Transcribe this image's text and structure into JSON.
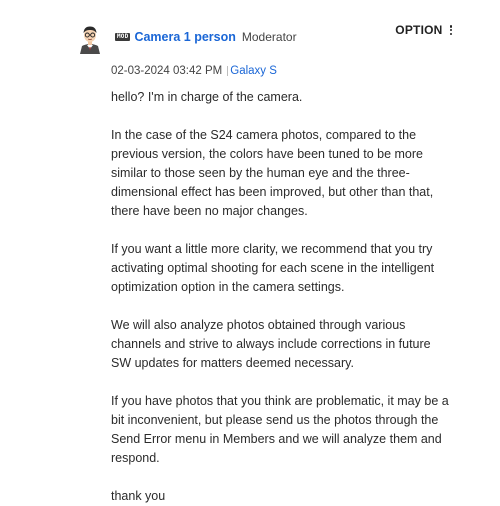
{
  "post": {
    "badge": "MOD",
    "author": "Camera 1 person",
    "role": "Moderator",
    "option_label": "OPTION",
    "date": "02-03-2024 03:42 PM",
    "board": "Galaxy S",
    "paragraphs": [
      "hello? I'm in charge of the camera.",
      "In the case of the S24 camera photos, compared to the previous version, the colors have been tuned to be more similar to those seen by the human eye and the three-dimensional effect has been improved, but other than that, there have been no major changes.",
      "If you want a little more clarity, we recommend that you try activating optimal shooting for each scene in the intelligent optimization option in the camera settings.",
      "We will also analyze photos obtained through various channels and strive to always include corrections in future SW updates for matters deemed necessary.",
      "If you have photos that you think are problematic, it may be a bit inconvenient, but please send us the photos through the Send Error menu in Members and we will analyze them and respond.",
      "thank you"
    ]
  },
  "colors": {
    "link": "#1a66d6",
    "text": "#2b2b2b",
    "badge_bg": "#3a3a3a"
  },
  "icons": {
    "avatar": "cartoon-person-with-glasses-avatar",
    "menu": "kebab-vertical-icon"
  }
}
